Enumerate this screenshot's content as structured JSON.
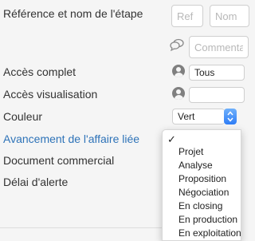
{
  "form": {
    "reference_label": "Référence et nom de l'étape",
    "ref_placeholder": "Ref",
    "name_placeholder": "Nom",
    "comment_placeholder": "Commentaire",
    "full_access_label": "Accès complet",
    "full_access_value": "Tous",
    "view_access_label": "Accès visualisation",
    "view_access_value": "",
    "color_label": "Couleur",
    "color_value": "Vert",
    "progress_label": "Avancement de l'affaire liée",
    "document_label": "Document commercial",
    "alert_label": "Délai d'alerte"
  },
  "dropdown": {
    "check_mark": "✓",
    "selected_value": "",
    "options": [
      "Projet",
      "Analyse",
      "Proposition",
      "Négociation",
      "En closing",
      "En production",
      "En exploitation"
    ]
  },
  "colors": {
    "link": "#2e73b8",
    "accent": "#2e7df6"
  }
}
